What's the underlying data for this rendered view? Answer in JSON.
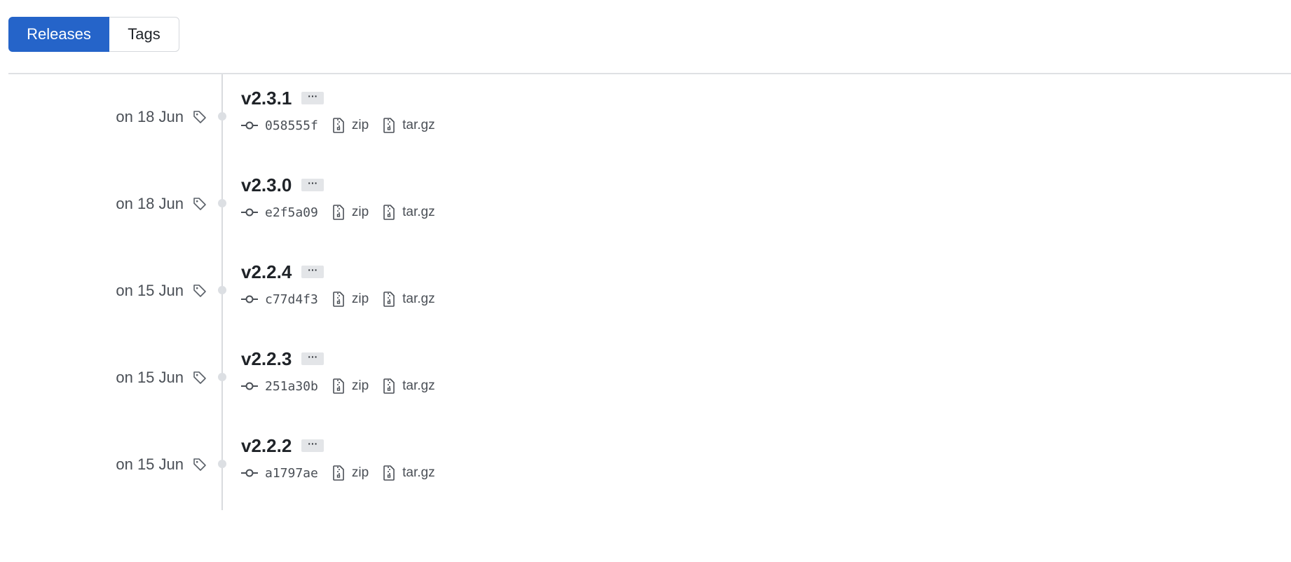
{
  "tabs": {
    "releases_label": "Releases",
    "tags_label": "Tags",
    "active": "releases"
  },
  "colors": {
    "accent": "#2564c9",
    "timeline": "#d9dbde",
    "text_muted": "#4a4f56"
  },
  "releases": [
    {
      "date": "on 18 Jun",
      "version": "v2.3.1",
      "more": "···",
      "commit": "058555f",
      "zip": "zip",
      "targz": "tar.gz"
    },
    {
      "date": "on 18 Jun",
      "version": "v2.3.0",
      "more": "···",
      "commit": "e2f5a09",
      "zip": "zip",
      "targz": "tar.gz"
    },
    {
      "date": "on 15 Jun",
      "version": "v2.2.4",
      "more": "···",
      "commit": "c77d4f3",
      "zip": "zip",
      "targz": "tar.gz"
    },
    {
      "date": "on 15 Jun",
      "version": "v2.2.3",
      "more": "···",
      "commit": "251a30b",
      "zip": "zip",
      "targz": "tar.gz"
    },
    {
      "date": "on 15 Jun",
      "version": "v2.2.2",
      "more": "···",
      "commit": "a1797ae",
      "zip": "zip",
      "targz": "tar.gz"
    }
  ],
  "icons": {
    "tag": "tag-icon",
    "commit": "commit-icon",
    "archive": "file-zip-icon"
  }
}
